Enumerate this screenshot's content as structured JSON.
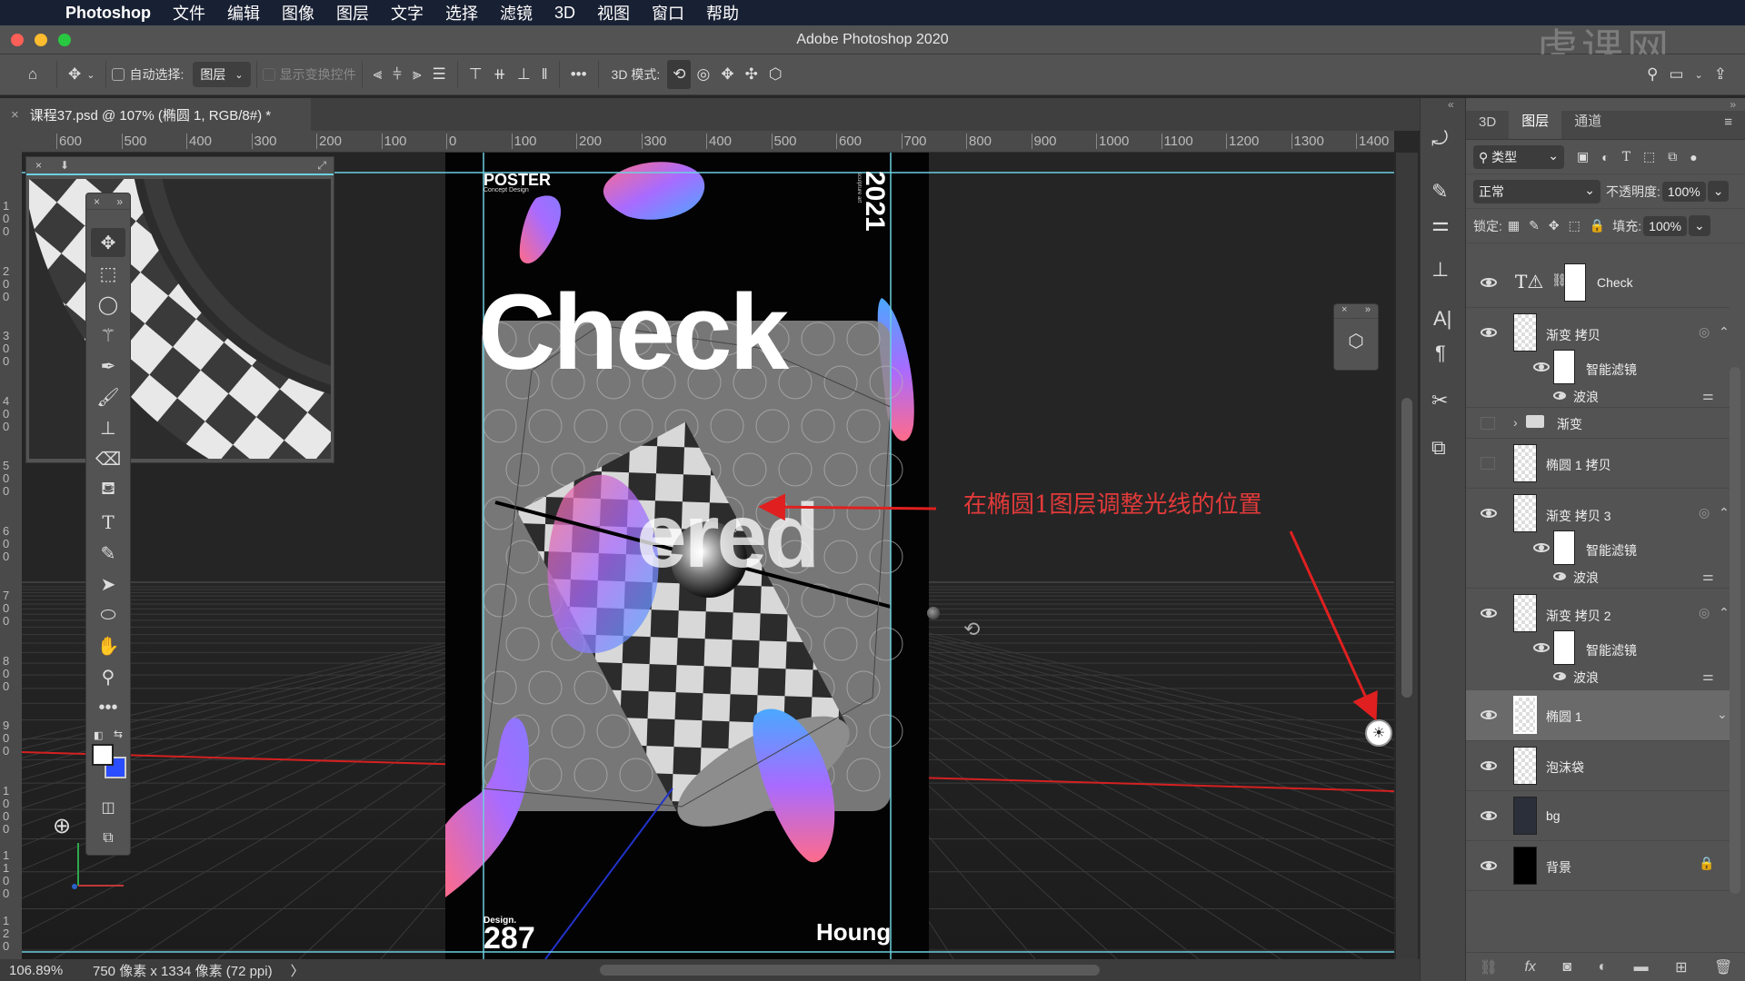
{
  "menubar": {
    "apple": "",
    "app_name": "Photoshop",
    "items": [
      "文件",
      "编辑",
      "图像",
      "图层",
      "文字",
      "选择",
      "滤镜",
      "3D",
      "视图",
      "窗口",
      "帮助"
    ]
  },
  "window": {
    "title": "Adobe Photoshop 2020"
  },
  "watermark": "虎课网",
  "options_bar": {
    "auto_select_label": "自动选择:",
    "auto_select_value": "图层",
    "show_transform_label": "显示变换控件",
    "more": "•••",
    "mode_3d_label": "3D 模式:"
  },
  "document_tab": {
    "close": "×",
    "title": "课程37.psd @ 107% (椭圆 1, RGB/8#) *"
  },
  "ruler": {
    "horizontal": [
      "600",
      "500",
      "400",
      "300",
      "200",
      "100",
      "0",
      "100",
      "200",
      "300",
      "400",
      "500",
      "600",
      "700",
      "800",
      "900",
      "1000",
      "1100",
      "1200",
      "1300",
      "1400"
    ],
    "vertical": [
      "1 0 0",
      "2 0 0",
      "3 0 0",
      "4 0 0",
      "5 0 0",
      "6 0 0",
      "7 0 0",
      "8 0 0",
      "9 0 0",
      "1 0 0 0",
      "1 1 0 0",
      "1 2 0"
    ]
  },
  "status": {
    "zoom": "106.89%",
    "doc_info": "750 像素 x 1334 像素 (72 ppi)",
    "arrow": "〉"
  },
  "poster": {
    "poster_title": "POSTER",
    "poster_sub": "Concept Design",
    "year": "2021",
    "year_sub": "sculpture art",
    "headline": "Check",
    "headline2": "ered",
    "design_label": "Design.",
    "design_number": "287",
    "author": "Houng"
  },
  "annotation": {
    "text": "在椭圆1图层调整光线的位置",
    "color": "#e23a3a"
  },
  "panel": {
    "collapse_left": "«",
    "collapse_right": "»",
    "tabs": [
      "3D",
      "图层",
      "通道"
    ],
    "active_tab": "图层",
    "filter_label": "类型",
    "blend_mode": "正常",
    "opacity_label": "不透明度:",
    "opacity_value": "100%",
    "lock_label": "锁定:",
    "fill_label": "填充:",
    "fill_value": "100%",
    "layers": [
      {
        "name": "Check",
        "type": "text",
        "visible": true
      },
      {
        "name": "渐变 拷贝",
        "type": "smart",
        "visible": true,
        "smart_filter": "智能滤镜",
        "filter": "波浪"
      },
      {
        "name": "渐变",
        "type": "group",
        "visible": false
      },
      {
        "name": "椭圆 1 拷贝",
        "type": "smart",
        "visible": false
      },
      {
        "name": "渐变 拷贝 3",
        "type": "smart",
        "visible": true,
        "smart_filter": "智能滤镜",
        "filter": "波浪"
      },
      {
        "name": "渐变 拷贝 2",
        "type": "smart",
        "visible": true,
        "smart_filter": "智能滤镜",
        "filter": "波浪"
      },
      {
        "name": "椭圆 1",
        "type": "3d",
        "visible": true,
        "selected": true
      },
      {
        "name": "泡沫袋",
        "type": "smart",
        "visible": true
      },
      {
        "name": "bg",
        "type": "smart",
        "visible": true
      },
      {
        "name": "背景",
        "type": "background",
        "visible": true,
        "locked": true
      }
    ]
  },
  "colors": {
    "foreground": "#ffffff",
    "background": "#2a4dff",
    "guide": "#6ccfe0",
    "gradient_a": "#a86bff",
    "gradient_b": "#ff6b8a",
    "gradient_c": "#4aa8ff"
  }
}
